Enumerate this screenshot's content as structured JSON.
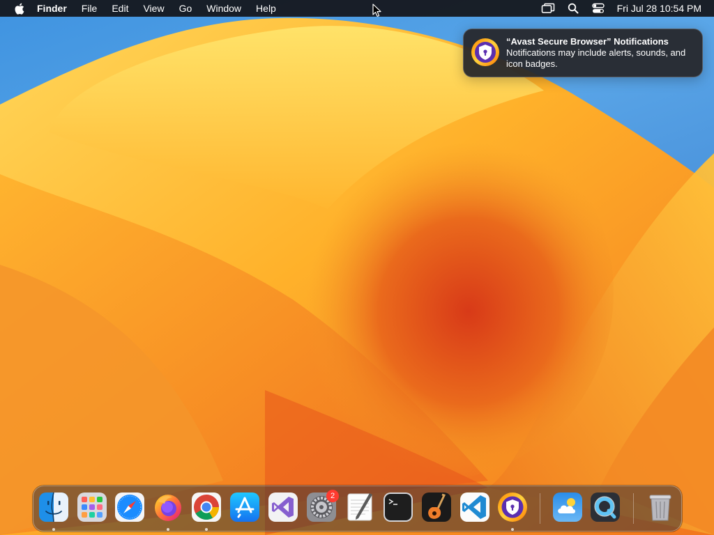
{
  "menubar": {
    "app_name": "Finder",
    "items": [
      "File",
      "Edit",
      "View",
      "Go",
      "Window",
      "Help"
    ],
    "clock": "Fri Jul 28  10:54 PM",
    "status_icons": [
      "screen-mirroring-icon",
      "spotlight-search-icon",
      "control-center-icon"
    ]
  },
  "notification": {
    "title": "“Avast Secure Browser” Notifications",
    "body": "Notifications may include alerts, sounds, and icon badges.",
    "icon": "avast-secure-browser-icon"
  },
  "dock": {
    "items": [
      {
        "name": "Finder",
        "icon": "finder-icon",
        "running": true
      },
      {
        "name": "Launchpad",
        "icon": "launchpad-icon",
        "running": false
      },
      {
        "name": "Safari",
        "icon": "safari-icon",
        "running": false
      },
      {
        "name": "Firefox",
        "icon": "firefox-icon",
        "running": true
      },
      {
        "name": "Google Chrome",
        "icon": "chrome-icon",
        "running": true
      },
      {
        "name": "App Store",
        "icon": "app-store-icon",
        "running": false
      },
      {
        "name": "Visual Studio",
        "icon": "visual-studio-icon",
        "running": false
      },
      {
        "name": "System Settings",
        "icon": "system-settings-icon",
        "running": false,
        "badge": "2"
      },
      {
        "name": "TextEdit",
        "icon": "textedit-icon",
        "running": false
      },
      {
        "name": "Terminal",
        "icon": "terminal-icon",
        "running": false
      },
      {
        "name": "GarageBand",
        "icon": "garageband-icon",
        "running": false
      },
      {
        "name": "Visual Studio Code",
        "icon": "vscode-icon",
        "running": false
      },
      {
        "name": "Avast Secure Browser",
        "icon": "avast-secure-browser-icon",
        "running": true
      },
      {
        "name": "Weather",
        "icon": "weather-icon",
        "running": false
      },
      {
        "name": "QuickTime Player",
        "icon": "quicktime-icon",
        "running": false
      },
      {
        "name": "Trash",
        "icon": "trash-icon",
        "running": false
      }
    ]
  },
  "colors": {
    "menubar_bg": "#141418",
    "wallpaper_orange": "#f5a623",
    "wallpaper_red": "#e2461e",
    "wallpaper_blue": "#3f93e0",
    "badge_red": "#ff3b30"
  }
}
